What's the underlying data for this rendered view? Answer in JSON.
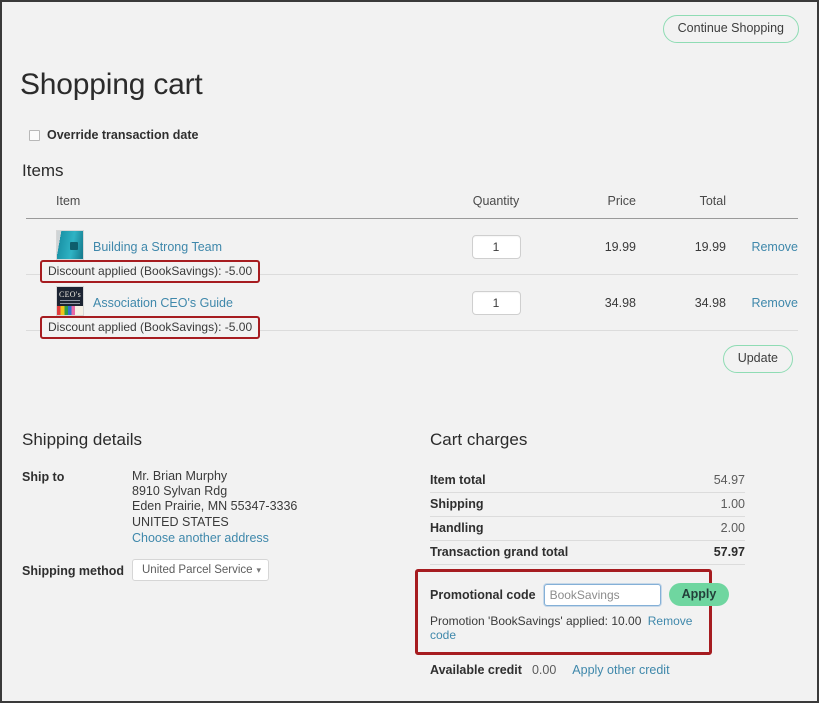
{
  "header": {
    "continue_shopping_label": "Continue Shopping",
    "page_title": "Shopping cart"
  },
  "override": {
    "label": "Override transaction date",
    "checked": false
  },
  "items_section": {
    "heading": "Items",
    "columns": {
      "item": "Item",
      "quantity": "Quantity",
      "price": "Price",
      "total": "Total"
    },
    "rows": [
      {
        "title": "Building a Strong Team",
        "quantity": "1",
        "price": "19.99",
        "total": "19.99",
        "remove_label": "Remove",
        "discount_note": "Discount applied (BookSavings): -5.00"
      },
      {
        "title": "Association CEO's Guide",
        "quantity": "1",
        "price": "34.98",
        "total": "34.98",
        "remove_label": "Remove",
        "discount_note": "Discount applied (BookSavings): -5.00"
      }
    ],
    "update_label": "Update",
    "thumb_b_text": "CEO's"
  },
  "shipping": {
    "heading": "Shipping details",
    "ship_to_label": "Ship to",
    "address": {
      "name": "Mr. Brian Murphy",
      "street": "8910 Sylvan Rdg",
      "city_state_zip": "Eden Prairie, MN 55347-3336",
      "country": "UNITED STATES"
    },
    "choose_address_label": "Choose another address",
    "method_label": "Shipping method",
    "method_value": "United Parcel Service"
  },
  "charges": {
    "heading": "Cart charges",
    "rows": [
      {
        "name": "Item total",
        "value": "54.97"
      },
      {
        "name": "Shipping",
        "value": "1.00"
      },
      {
        "name": "Handling",
        "value": "2.00"
      },
      {
        "name": "Transaction grand total",
        "value": "57.97"
      }
    ]
  },
  "promo": {
    "label": "Promotional code",
    "input_value": "BookSavings",
    "input_placeholder": "BookSavings",
    "apply_label": "Apply",
    "applied_text": "Promotion 'BookSavings' applied: 10.00",
    "remove_label": "Remove code"
  },
  "credit": {
    "label": "Available credit",
    "value": "0.00",
    "link_label": "Apply other credit"
  },
  "colors": {
    "accent_green": "#6fd6a0",
    "outline_green": "#8fdcb4",
    "link_blue": "#3f88ab",
    "annotation_red": "#a61c20",
    "page_bg": "#f2f2f2"
  }
}
